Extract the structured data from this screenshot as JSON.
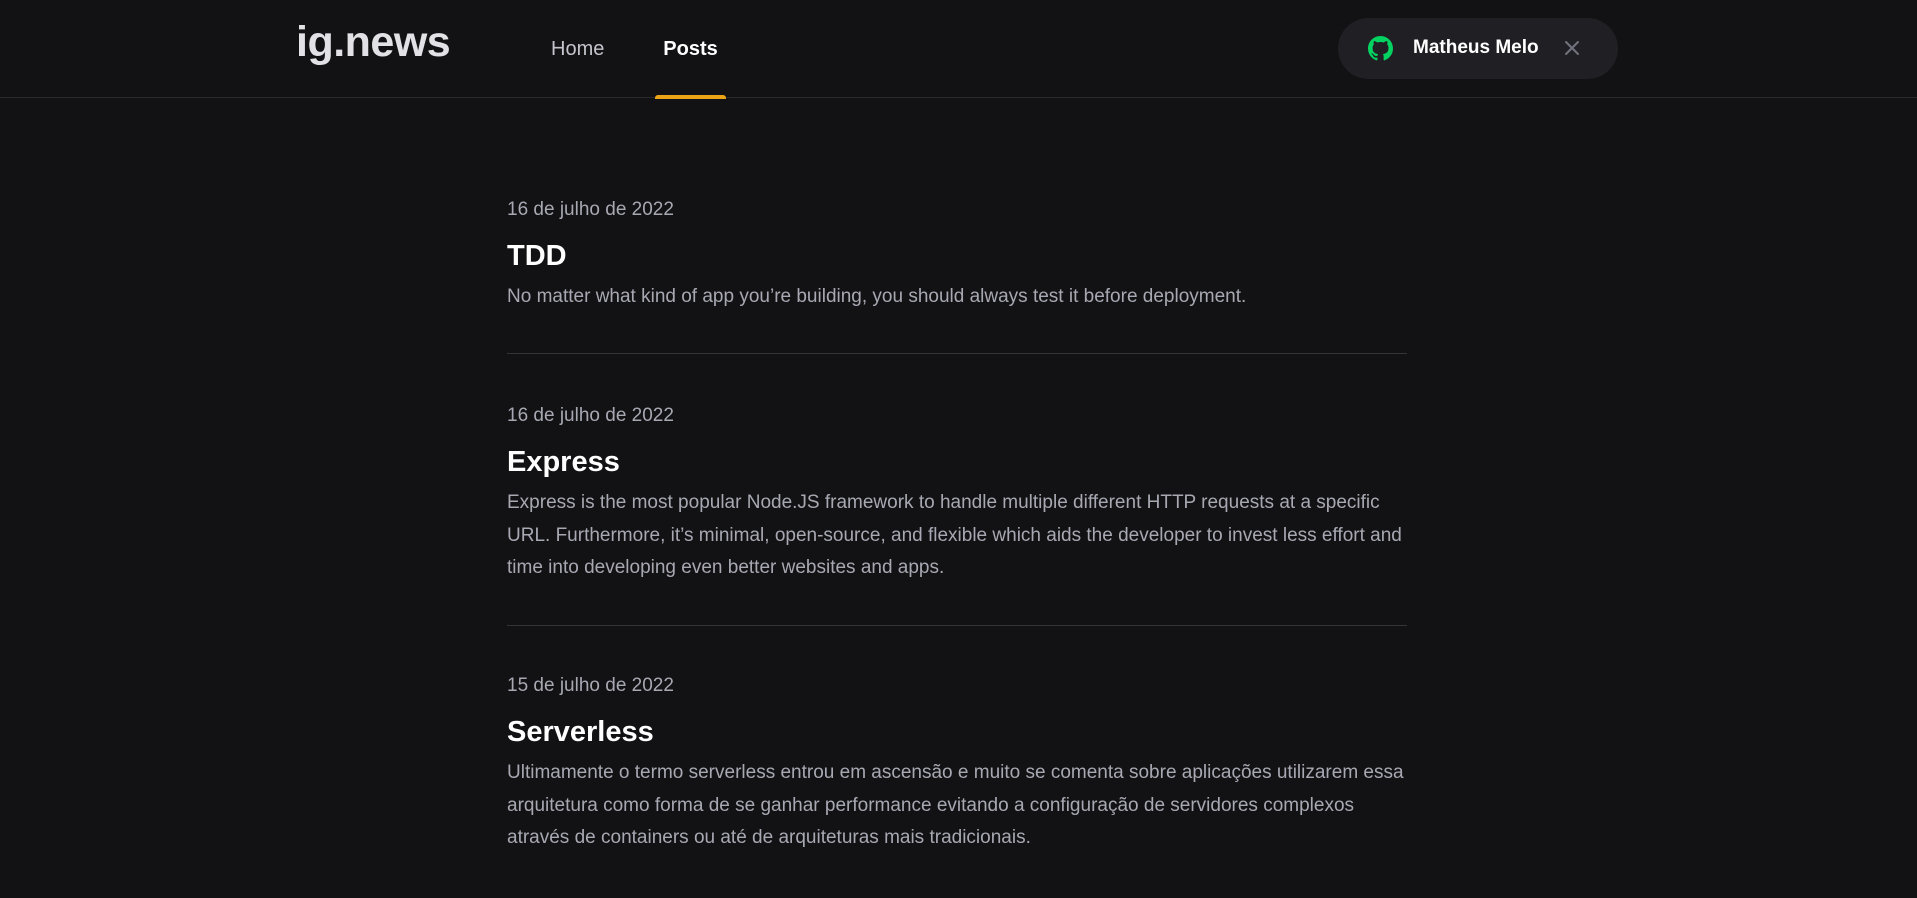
{
  "header": {
    "logo": "ig.news",
    "nav": [
      {
        "label": "Home",
        "active": false
      },
      {
        "label": "Posts",
        "active": true
      }
    ],
    "user": {
      "name": "Matheus Melo",
      "provider_icon": "github-icon",
      "icon_color": "#04d361",
      "close_icon": "close-icon"
    }
  },
  "posts": [
    {
      "date": "16 de julho de 2022",
      "title": "TDD",
      "excerpt": "No matter what kind of app you’re building, you should always test it before deployment."
    },
    {
      "date": "16 de julho de 2022",
      "title": "Express",
      "excerpt": "Express is the most popular Node.JS framework to handle multiple different HTTP requests at a specific URL. Furthermore, it’s minimal, open-source, and flexible which aids the developer to invest less effort and time into developing even better websites and apps."
    },
    {
      "date": "15 de julho de 2022",
      "title": "Serverless",
      "excerpt": "Ultimamente o termo serverless entrou em ascensão e muito se comenta sobre aplicações utilizarem essa arquitetura como forma de se ganhar performance evitando a configuração de servidores complexos através de containers ou até de arquiteturas mais tradicionais."
    }
  ],
  "colors": {
    "background": "#121214",
    "accent": "#eba417",
    "github_green": "#04d361"
  }
}
